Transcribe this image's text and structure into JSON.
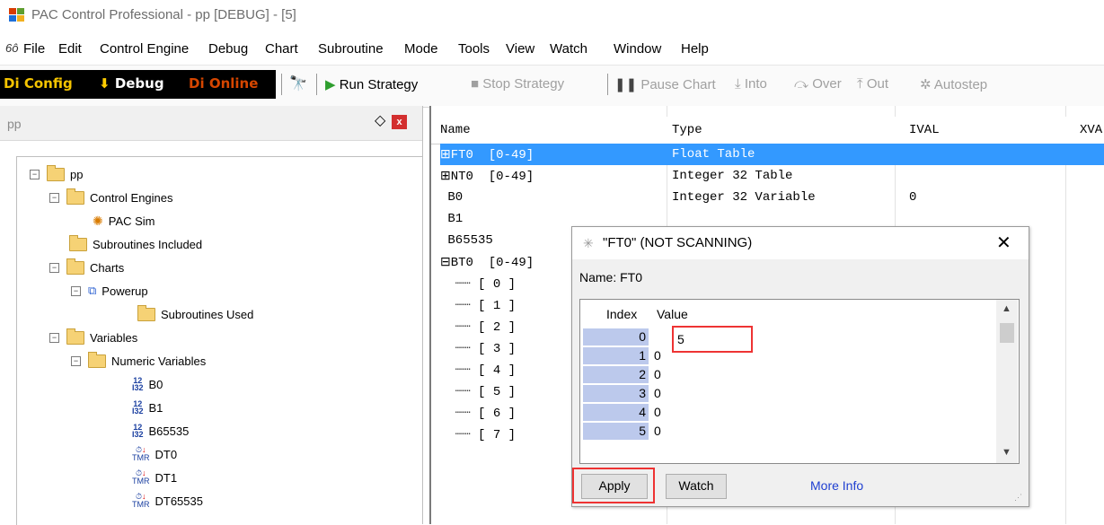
{
  "window": {
    "title": "PAC Control Professional - pp [DEBUG] - [5]"
  },
  "menu": [
    "File",
    "Edit",
    "Control Engine",
    "Debug",
    "Chart",
    "Subroutine",
    "Mode",
    "Tools",
    "View",
    "Watch",
    "Window",
    "Help"
  ],
  "toolbar": {
    "config": "Config",
    "debug": "Debug",
    "online": "Online",
    "run": "Run Strategy",
    "stop": "Stop Strategy",
    "pause": "Pause Chart",
    "into": "Into",
    "over": "Over",
    "out": "Out",
    "autostep": "Autostep"
  },
  "left_panel": {
    "title": "pp",
    "tree": [
      {
        "label": "pp",
        "toggle": "−",
        "icon": "folder"
      },
      {
        "label": "Control Engines",
        "toggle": "−",
        "icon": "folder"
      },
      {
        "label": "PAC Sim",
        "toggle": "",
        "icon": "gear"
      },
      {
        "label": "Subroutines Included",
        "toggle": "",
        "icon": "folder"
      },
      {
        "label": "Charts",
        "toggle": "−",
        "icon": "folder"
      },
      {
        "label": "Powerup",
        "toggle": "−",
        "icon": "chart"
      },
      {
        "label": "Subroutines Used",
        "toggle": "",
        "icon": "folder"
      },
      {
        "label": "Variables",
        "toggle": "−",
        "icon": "folder"
      },
      {
        "label": "Numeric Variables",
        "toggle": "−",
        "icon": "folder"
      },
      {
        "label": "B0",
        "toggle": "",
        "icon": "i32"
      },
      {
        "label": "B1",
        "toggle": "",
        "icon": "i32"
      },
      {
        "label": "B65535",
        "toggle": "",
        "icon": "i32"
      },
      {
        "label": "DT0",
        "toggle": "",
        "icon": "tmr"
      },
      {
        "label": "DT1",
        "toggle": "",
        "icon": "tmr"
      },
      {
        "label": "DT65535",
        "toggle": "",
        "icon": "tmr"
      }
    ]
  },
  "grid": {
    "headers": [
      "Name",
      "Type",
      "IVAL",
      "XVA"
    ],
    "rows": [
      {
        "name": "⊞FT0  [0-49]",
        "type": "Float Table",
        "ival": "",
        "selected": true
      },
      {
        "name": "⊞NT0  [0-49]",
        "type": "Integer 32 Table",
        "ival": ""
      },
      {
        "name": " B0",
        "type": "Integer 32 Variable",
        "ival": "0"
      },
      {
        "name": " B1",
        "type": "",
        "ival": ""
      },
      {
        "name": " B65535",
        "type": "",
        "ival": ""
      },
      {
        "name": "⊟BT0  [0-49]",
        "type": "",
        "ival": ""
      },
      {
        "name": "  ┈┈ [ 0 ]",
        "type": "",
        "ival": ""
      },
      {
        "name": "  ┈┈ [ 1 ]",
        "type": "",
        "ival": ""
      },
      {
        "name": "  ┈┈ [ 2 ]",
        "type": "",
        "ival": ""
      },
      {
        "name": "  ┈┈ [ 3 ]",
        "type": "",
        "ival": ""
      },
      {
        "name": "  ┈┈ [ 4 ]",
        "type": "",
        "ival": ""
      },
      {
        "name": "  ┈┈ [ 5 ]",
        "type": "",
        "ival": ""
      },
      {
        "name": "  ┈┈ [ 6 ]",
        "type": "",
        "ival": ""
      },
      {
        "name": "  ┈┈ [ 7 ]",
        "type": "",
        "ival": ""
      }
    ]
  },
  "dialog": {
    "title": "\"FT0\" (NOT SCANNING)",
    "name_label": "Name:  FT0",
    "col_index": "Index",
    "col_value": "Value",
    "rows": [
      {
        "index": "0",
        "value": "5"
      },
      {
        "index": "1",
        "value": "0"
      },
      {
        "index": "2",
        "value": "0"
      },
      {
        "index": "3",
        "value": "0"
      },
      {
        "index": "4",
        "value": "0"
      },
      {
        "index": "5",
        "value": "0"
      }
    ],
    "apply": "Apply",
    "watch": "Watch",
    "more_info": "More Info"
  },
  "colors": {
    "selection": "#3399ff",
    "index_cell": "#bcc9ec",
    "highlight": "#ee3333",
    "link": "#1f3fd1"
  }
}
